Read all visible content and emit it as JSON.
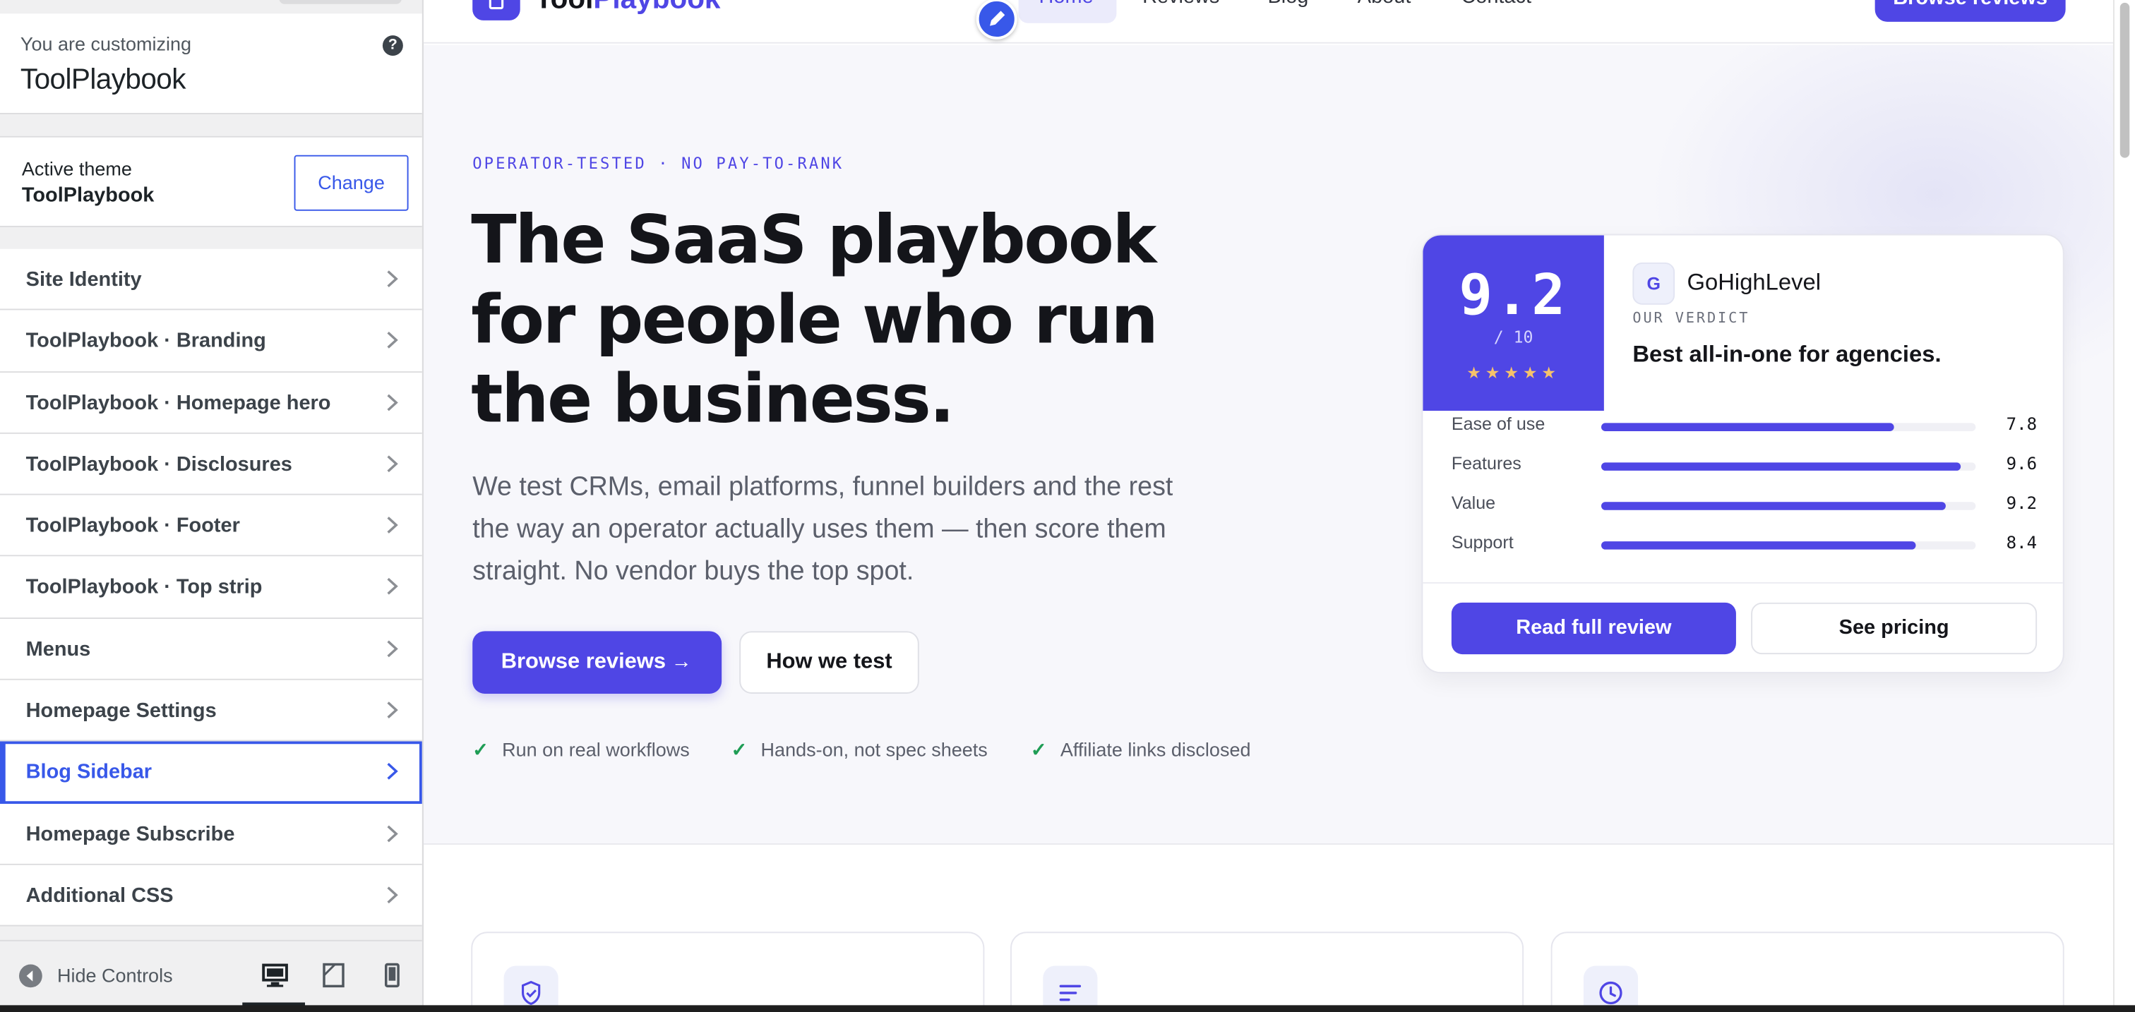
{
  "customizer": {
    "customizing_label": "You are customizing",
    "site_title": "ToolPlaybook",
    "help_icon": "help-icon",
    "theme": {
      "label": "Active theme",
      "name": "ToolPlaybook",
      "change_label": "Change"
    },
    "sections": [
      {
        "label": "Site Identity"
      },
      {
        "label": "ToolPlaybook · Branding"
      },
      {
        "label": "ToolPlaybook · Homepage hero"
      },
      {
        "label": "ToolPlaybook · Disclosures"
      },
      {
        "label": "ToolPlaybook · Footer"
      },
      {
        "label": "ToolPlaybook · Top strip"
      },
      {
        "label": "Menus"
      },
      {
        "label": "Homepage Settings"
      },
      {
        "label": "Blog Sidebar"
      },
      {
        "label": "Homepage Subscribe"
      },
      {
        "label": "Additional CSS"
      }
    ],
    "active_section": "Blog Sidebar",
    "footer": {
      "hide_label": "Hide Controls",
      "active_device": "desktop"
    }
  },
  "site": {
    "logo": {
      "prefix": "Tool",
      "accent": "Playbook"
    },
    "nav": [
      "Home",
      "Reviews",
      "Blog",
      "About",
      "Contact"
    ],
    "header_cta": "Browse reviews",
    "hero": {
      "kicker": "OPERATOR-TESTED · NO PAY-TO-RANK",
      "headline": "The SaaS playbook for people who run the business.",
      "subheadline": "We test CRMs, email platforms, funnel builders and the rest the way an operator actually uses them — then score them straight. No vendor buys the top spot.",
      "primary_cta": "Browse reviews",
      "secondary_cta": "How we test",
      "trust_points": [
        "Run on real workflows",
        "Hands-on, not spec sheets",
        "Affiliate links disclosed"
      ]
    },
    "review_card": {
      "score": "9.2",
      "score_of": "/ 10",
      "stars": "★★★★★",
      "rating": 4.6,
      "product_initial": "G",
      "product_name": "GoHighLevel",
      "verdict_label": "OUR VERDICT",
      "verdict": "Best all-in-one for agencies.",
      "metrics": [
        {
          "label": "Ease of use",
          "value": "7.8",
          "score": 7.8
        },
        {
          "label": "Features",
          "value": "9.6",
          "score": 9.6
        },
        {
          "label": "Value",
          "value": "9.2",
          "score": 9.2
        },
        {
          "label": "Support",
          "value": "8.4",
          "score": 8.4
        }
      ],
      "primary_button": "Read full review",
      "secondary_button": "See pricing"
    },
    "feature_icons": [
      "shield-check-icon",
      "lines-icon",
      "clock-icon"
    ]
  },
  "colors": {
    "brand": "#4f46e5",
    "wp_accent": "#3858e9",
    "check": "#1f9d55"
  }
}
